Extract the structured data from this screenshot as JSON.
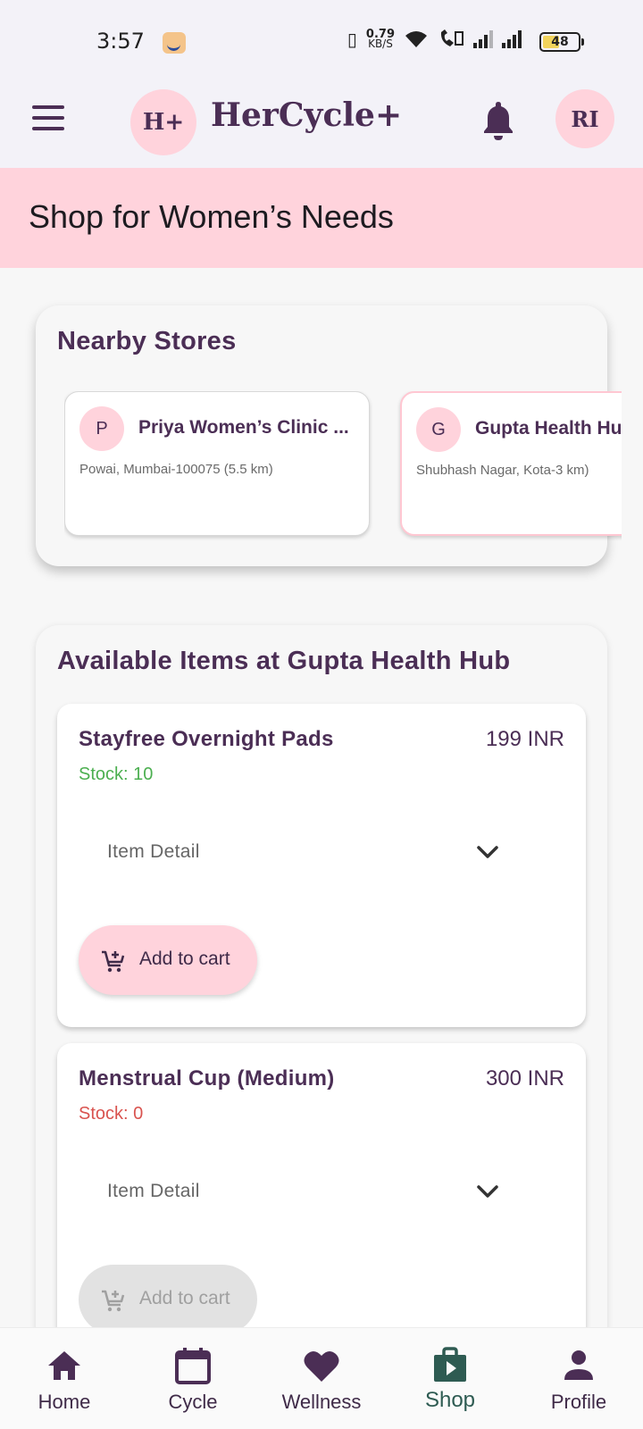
{
  "status_bar": {
    "time": "3:57",
    "speed_value": "0.79",
    "speed_unit": "KB/S",
    "battery": "48",
    "battery_level": 0.48,
    "icons": [
      "amazon-app-icon",
      "vibrate-icon",
      "wifi-icon",
      "wifi-calling-icon",
      "signal-icon",
      "signal-icon",
      "battery-icon"
    ]
  },
  "app_bar": {
    "logo_text": "H+",
    "title": "HerCycle+",
    "avatar_initials": "RI",
    "icons": [
      "menu-icon",
      "bell-icon"
    ]
  },
  "header": {
    "title": "Shop for Women’s Needs"
  },
  "stores": {
    "heading": "Nearby Stores",
    "items": [
      {
        "initial": "P",
        "name": "Priya Women’s Clinic ...",
        "address": "Powai, Mumbai-100075 (5.5 km)",
        "selected": false
      },
      {
        "initial": "G",
        "name": "Gupta Health Hub",
        "address": "Shubhash Nagar, Kota-3 km)",
        "selected": true
      }
    ]
  },
  "items_section": {
    "heading": "Available Items at Gupta Health Hub",
    "items": [
      {
        "name": "Stayfree Overnight Pads",
        "price": "199 INR",
        "stock": "Stock: 10",
        "stock_color": "#4caf50",
        "detail_label": "Item Detail",
        "add_label": "Add to cart",
        "enabled": true
      },
      {
        "name": "Menstrual Cup (Medium)",
        "price": "300 INR",
        "stock": "Stock: 0",
        "stock_color": "#d9534f",
        "detail_label": "Item Detail",
        "add_label": "Add to cart",
        "enabled": false
      }
    ]
  },
  "bottom_nav": {
    "items": [
      {
        "label": "Home",
        "icon": "home-icon",
        "active": false
      },
      {
        "label": "Cycle",
        "icon": "calendar-icon",
        "active": false
      },
      {
        "label": "Wellness",
        "icon": "heart-icon",
        "active": false
      },
      {
        "label": "Shop",
        "icon": "shop-bag-icon",
        "active": true
      },
      {
        "label": "Profile",
        "icon": "person-icon",
        "active": false
      }
    ]
  },
  "colors": {
    "primary": "#4b2e55",
    "accent_pink": "#ffd3dc",
    "active_nav": "#2e5b52",
    "in_stock": "#4caf50",
    "out_of_stock": "#d9534f"
  }
}
